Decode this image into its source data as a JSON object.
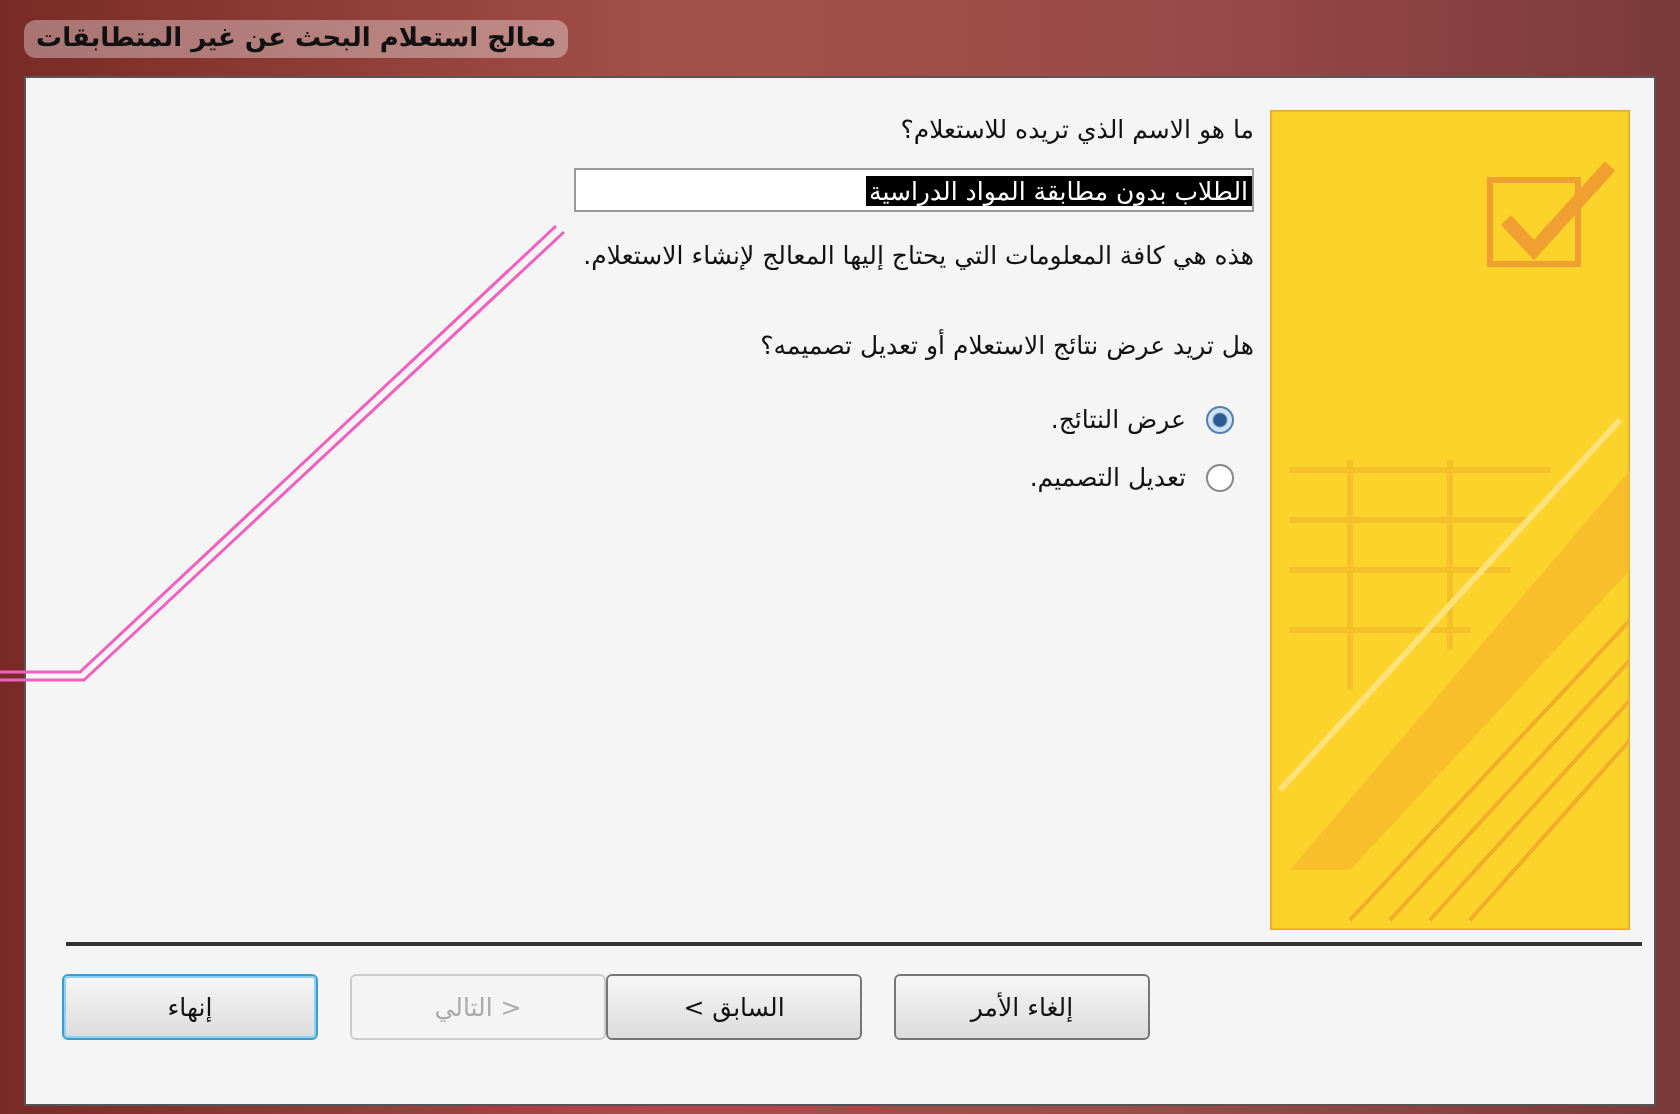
{
  "window": {
    "title": "معالج استعلام البحث عن غير المتطابقات"
  },
  "name_prompt": "ما هو الاسم الذي تريده للاستعلام؟",
  "name_field": {
    "value": "الطلاب بدون مطابقة المواد الدراسية",
    "selected": true
  },
  "info_text": "هذه هي كافة المعلومات التي يحتاج إليها المعالج لإنشاء الاستعلام.",
  "action_prompt": "هل تريد عرض نتائج الاستعلام أو تعديل تصميمه؟",
  "options": [
    {
      "label": "عرض النتائج.",
      "selected": true
    },
    {
      "label": "تعديل التصميم.",
      "selected": false
    }
  ],
  "buttons": [
    {
      "label": "إلغاء الأمر",
      "disabled": false,
      "default": false
    },
    {
      "label": "< السابق",
      "disabled": false,
      "default": false
    },
    {
      "label": "التالي >",
      "disabled": true,
      "default": false
    },
    {
      "label": "إنهاء",
      "disabled": false,
      "default": true
    }
  ]
}
